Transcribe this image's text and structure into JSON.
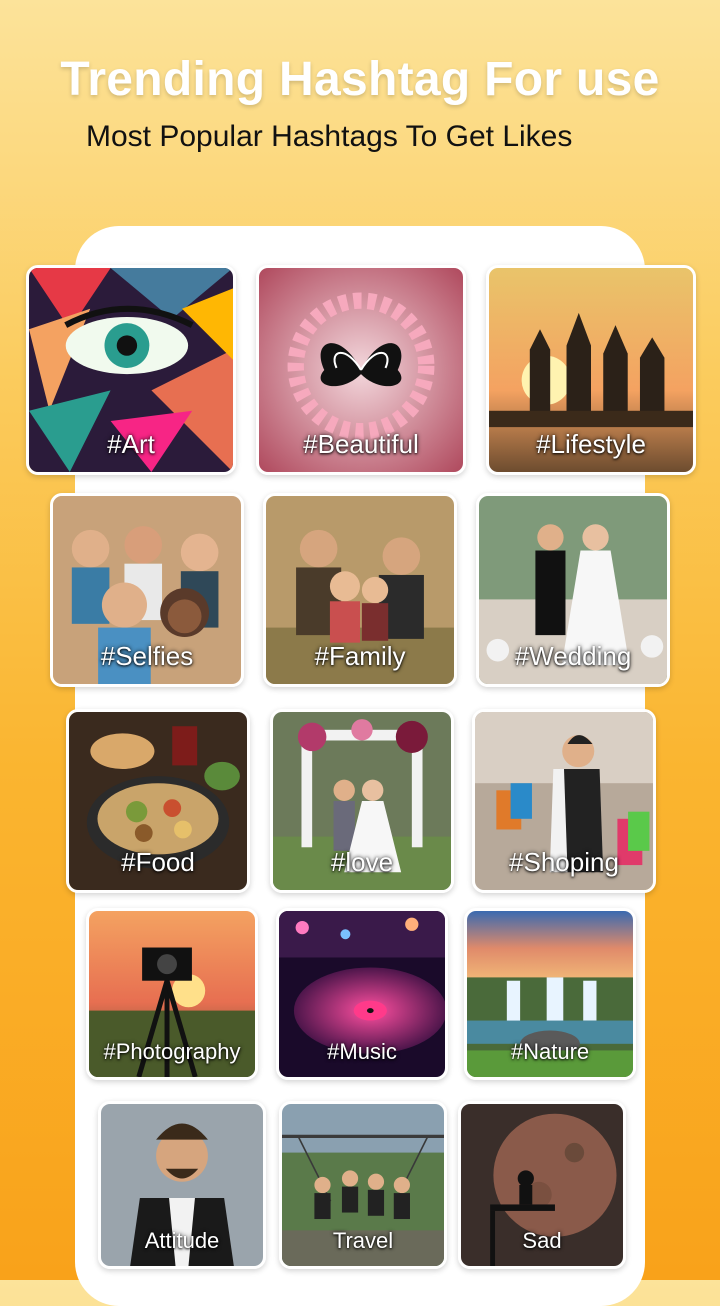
{
  "header": {
    "title": "Trending Hashtag For use",
    "subtitle": "Most Popular Hashtags To Get Likes"
  },
  "tags": [
    {
      "label": "#Art"
    },
    {
      "label": "#Beautiful"
    },
    {
      "label": "#Lifestyle"
    },
    {
      "label": "#Selfies"
    },
    {
      "label": "#Family"
    },
    {
      "label": "#Wedding"
    },
    {
      "label": "#Food"
    },
    {
      "label": "#love"
    },
    {
      "label": "#Shoping"
    },
    {
      "label": "#Photography"
    },
    {
      "label": "#Music"
    },
    {
      "label": "#Nature"
    },
    {
      "label": "Attitude"
    },
    {
      "label": "Travel"
    },
    {
      "label": "Sad"
    }
  ]
}
